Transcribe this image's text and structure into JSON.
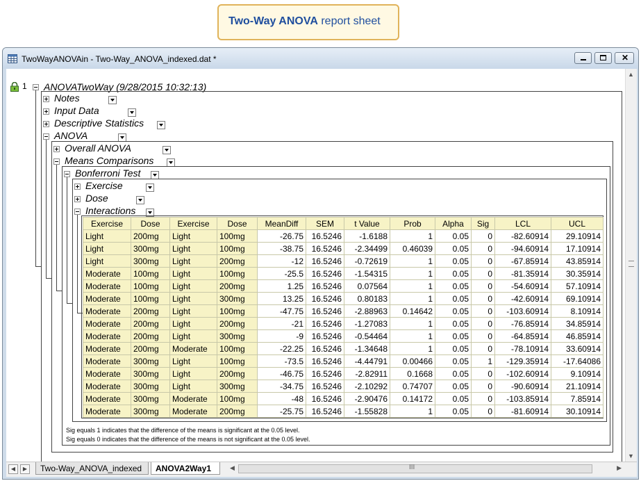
{
  "callout": {
    "bold": "Two-Way ANOVA",
    "rest": " report sheet"
  },
  "window": {
    "title": "TwoWayANOVAin - Two-Way_ANOVA_indexed.dat *"
  },
  "report": {
    "row_index": "1",
    "root_label": "ANOVATwoWay (9/28/2015 10:32:13)",
    "nodes": {
      "notes": "Notes",
      "input_data": "Input Data",
      "descriptive_statistics": "Descriptive Statistics",
      "anova": "ANOVA",
      "overall_anova": "Overall ANOVA",
      "means_comparisons": "Means Comparisons",
      "bonferroni_test": "Bonferroni Test",
      "exercise": "Exercise",
      "dose": "Dose",
      "interactions": "Interactions"
    }
  },
  "table": {
    "headers": [
      "Exercise",
      "Dose",
      "Exercise",
      "Dose",
      "MeanDiff",
      "SEM",
      "t Value",
      "Prob",
      "Alpha",
      "Sig",
      "LCL",
      "UCL"
    ],
    "rows": [
      [
        "Light",
        "200mg",
        "Light",
        "100mg",
        "-26.75",
        "16.5246",
        "-1.6188",
        "1",
        "0.05",
        "0",
        "-82.60914",
        "29.10914"
      ],
      [
        "Light",
        "300mg",
        "Light",
        "100mg",
        "-38.75",
        "16.5246",
        "-2.34499",
        "0.46039",
        "0.05",
        "0",
        "-94.60914",
        "17.10914"
      ],
      [
        "Light",
        "300mg",
        "Light",
        "200mg",
        "-12",
        "16.5246",
        "-0.72619",
        "1",
        "0.05",
        "0",
        "-67.85914",
        "43.85914"
      ],
      [
        "Moderate",
        "100mg",
        "Light",
        "100mg",
        "-25.5",
        "16.5246",
        "-1.54315",
        "1",
        "0.05",
        "0",
        "-81.35914",
        "30.35914"
      ],
      [
        "Moderate",
        "100mg",
        "Light",
        "200mg",
        "1.25",
        "16.5246",
        "0.07564",
        "1",
        "0.05",
        "0",
        "-54.60914",
        "57.10914"
      ],
      [
        "Moderate",
        "100mg",
        "Light",
        "300mg",
        "13.25",
        "16.5246",
        "0.80183",
        "1",
        "0.05",
        "0",
        "-42.60914",
        "69.10914"
      ],
      [
        "Moderate",
        "200mg",
        "Light",
        "100mg",
        "-47.75",
        "16.5246",
        "-2.88963",
        "0.14642",
        "0.05",
        "0",
        "-103.60914",
        "8.10914"
      ],
      [
        "Moderate",
        "200mg",
        "Light",
        "200mg",
        "-21",
        "16.5246",
        "-1.27083",
        "1",
        "0.05",
        "0",
        "-76.85914",
        "34.85914"
      ],
      [
        "Moderate",
        "200mg",
        "Light",
        "300mg",
        "-9",
        "16.5246",
        "-0.54464",
        "1",
        "0.05",
        "0",
        "-64.85914",
        "46.85914"
      ],
      [
        "Moderate",
        "200mg",
        "Moderate",
        "100mg",
        "-22.25",
        "16.5246",
        "-1.34648",
        "1",
        "0.05",
        "0",
        "-78.10914",
        "33.60914"
      ],
      [
        "Moderate",
        "300mg",
        "Light",
        "100mg",
        "-73.5",
        "16.5246",
        "-4.44791",
        "0.00466",
        "0.05",
        "1",
        "-129.35914",
        "-17.64086"
      ],
      [
        "Moderate",
        "300mg",
        "Light",
        "200mg",
        "-46.75",
        "16.5246",
        "-2.82911",
        "0.1668",
        "0.05",
        "0",
        "-102.60914",
        "9.10914"
      ],
      [
        "Moderate",
        "300mg",
        "Light",
        "300mg",
        "-34.75",
        "16.5246",
        "-2.10292",
        "0.74707",
        "0.05",
        "0",
        "-90.60914",
        "21.10914"
      ],
      [
        "Moderate",
        "300mg",
        "Moderate",
        "100mg",
        "-48",
        "16.5246",
        "-2.90476",
        "0.14172",
        "0.05",
        "0",
        "-103.85914",
        "7.85914"
      ],
      [
        "Moderate",
        "300mg",
        "Moderate",
        "200mg",
        "-25.75",
        "16.5246",
        "-1.55828",
        "1",
        "0.05",
        "0",
        "-81.60914",
        "30.10914"
      ]
    ]
  },
  "notes": [
    "Sig equals 1 indicates that the difference of the means is significant at the 0.05 level.",
    "Sig equals 0 indicates that the difference of the means is not significant at the 0.05 level."
  ],
  "tabs": [
    "Two-Way_ANOVA_indexed",
    "ANOVA2Way1"
  ],
  "scroll": {
    "thumb_grip": "III"
  }
}
